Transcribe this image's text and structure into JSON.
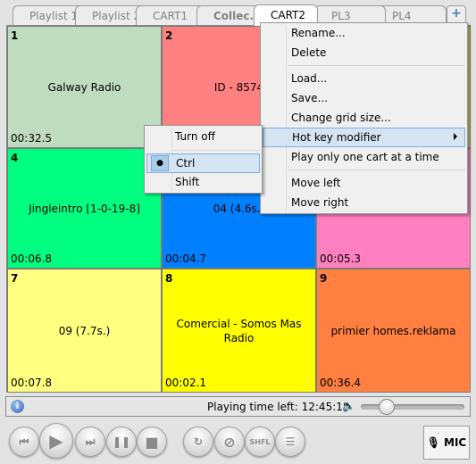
{
  "tabs": [
    {
      "label": "Playlist 1"
    },
    {
      "label": "Playlist 2"
    },
    {
      "label": "CART1"
    },
    {
      "label": "Collec..."
    },
    {
      "label": "CART2",
      "active": true
    },
    {
      "label": "PL3"
    },
    {
      "label": "PL4"
    }
  ],
  "add_tab_icon": "plus-icon",
  "carts": [
    {
      "num": "1",
      "title": "Galway Radio",
      "time": "00:32.5",
      "color": "#c0dcc0"
    },
    {
      "num": "2",
      "title": "ID - 8574",
      "time": "",
      "color": "#ff8080"
    },
    {
      "num": "",
      "title": "",
      "time": "",
      "color": "#c8c050"
    },
    {
      "num": "4",
      "title": "Jingleintro [1-0-19-8]",
      "time": "00:06.8",
      "color": "#00ff80"
    },
    {
      "num": "",
      "title": "04 (4.6s.)",
      "time": "00:04.7",
      "color": "#0080ff"
    },
    {
      "num": "",
      "title": "",
      "time": "00:05.3",
      "color": "#ff80c0"
    },
    {
      "num": "7",
      "title": "09 (7.7s.)",
      "time": "00:07.8",
      "color": "#ffff80"
    },
    {
      "num": "8",
      "title": "Comercial - Somos Mas Radio",
      "time": "00:02.1",
      "color": "#ffff00"
    },
    {
      "num": "9",
      "title": "primier homes.reklama",
      "time": "00:36.4",
      "color": "#ff8040"
    }
  ],
  "status": {
    "playing_time_label": "Playing time left: 12:45:18",
    "volume_percent": 20
  },
  "controls": {
    "shuffle_label": "SHFL",
    "mic_label": "MIC"
  },
  "context_menu": {
    "items": [
      "Rename...",
      "Delete",
      "Load...",
      "Save...",
      "Change grid size...",
      "Hot key modifier",
      "Play only one cart at a time",
      "Move left",
      "Move right"
    ]
  },
  "submenu": {
    "items": [
      "Turn off",
      "Ctrl",
      "Shift"
    ],
    "selected": "Ctrl"
  }
}
